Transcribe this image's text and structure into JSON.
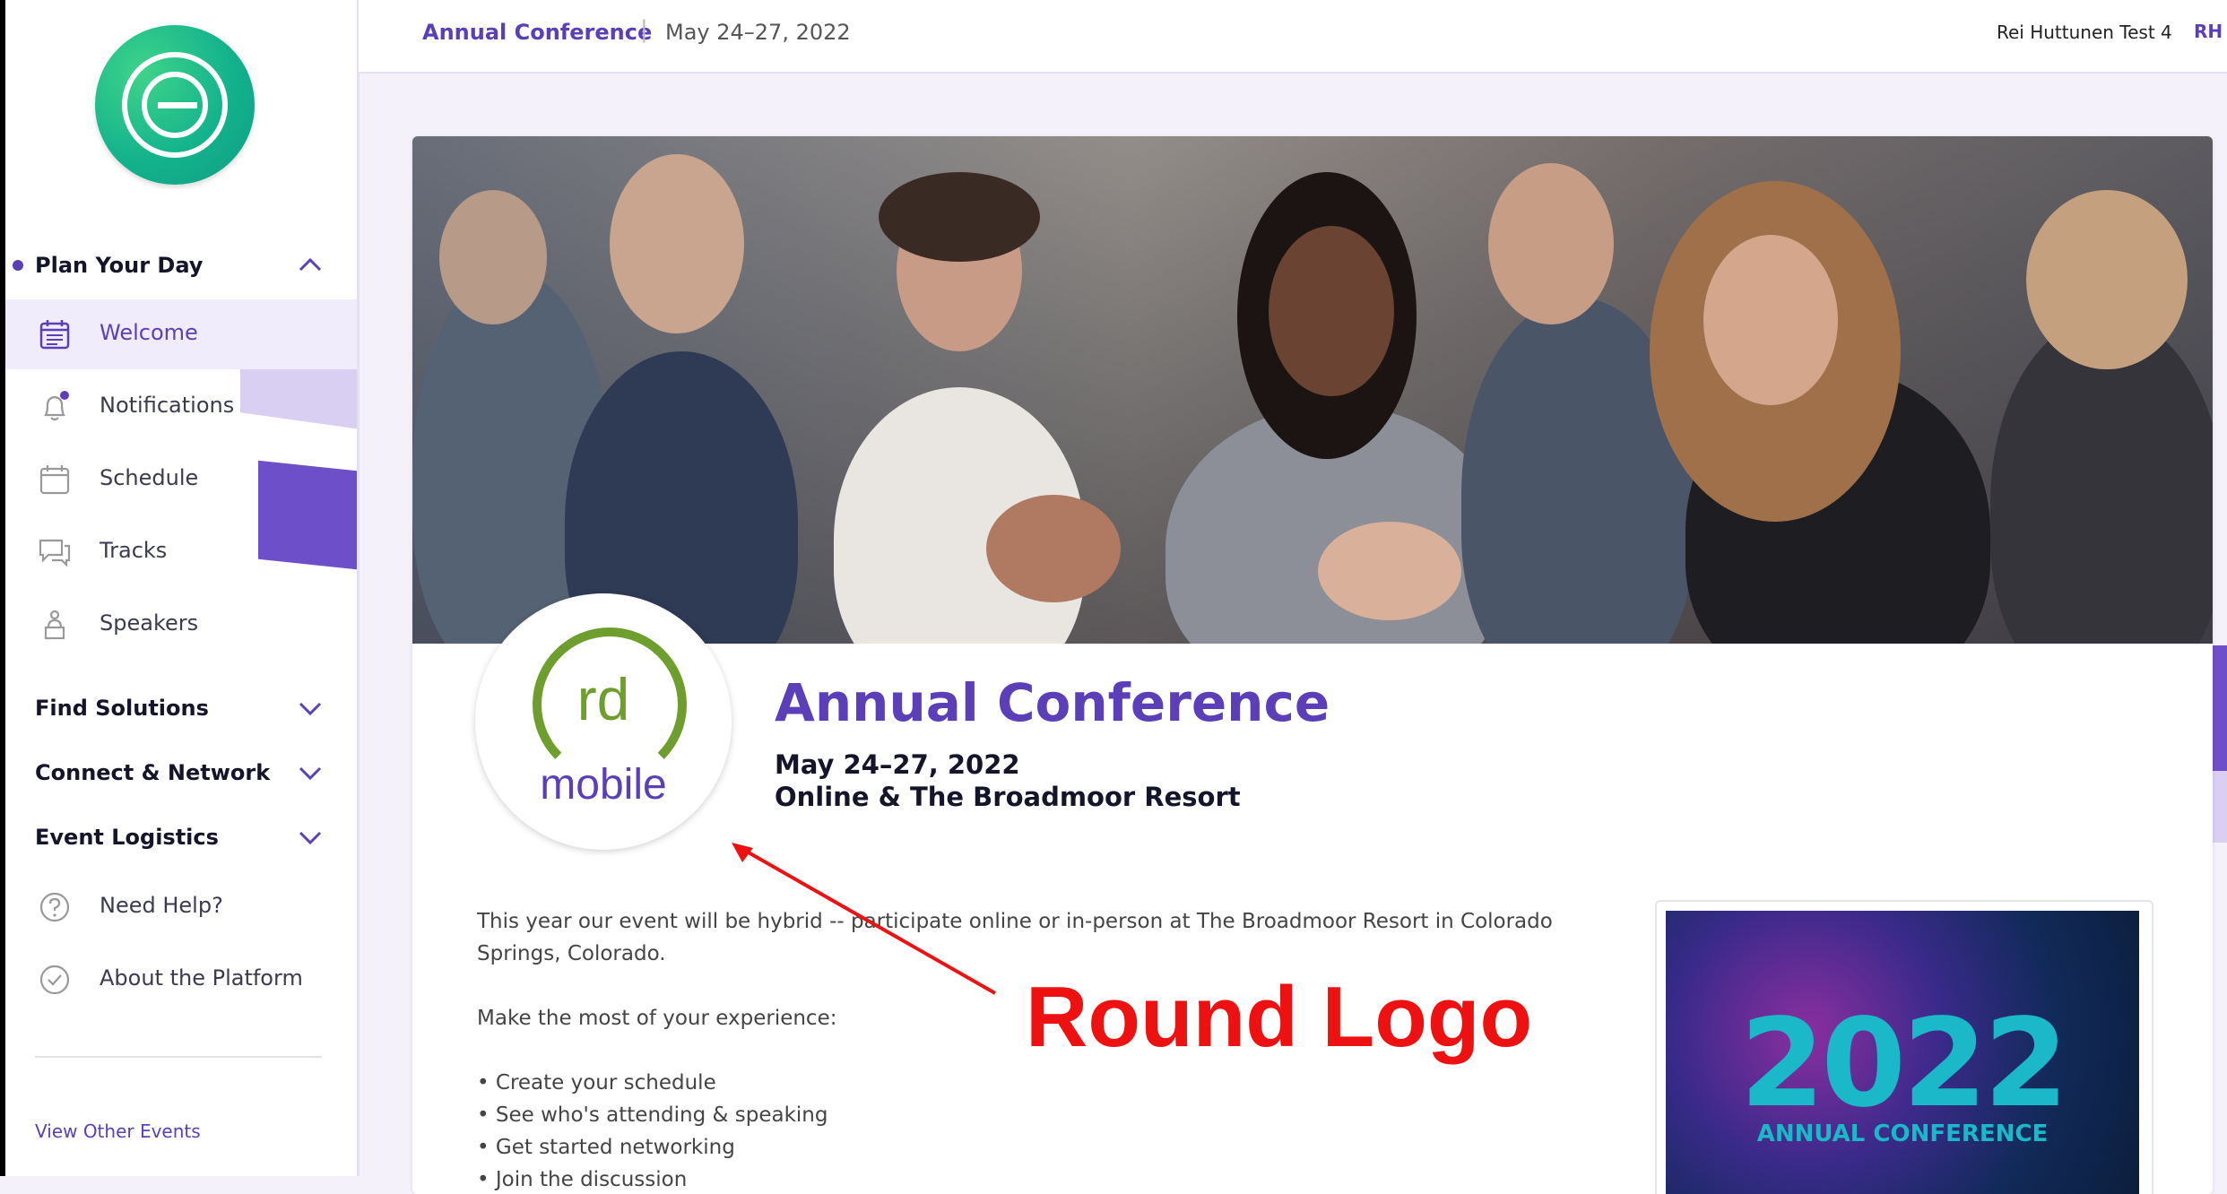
{
  "header": {
    "event_name": "Annual Conference",
    "separator": "|",
    "dates": "May 24–27, 2022",
    "user_name": "Rei Huttunen Test 4",
    "user_initials": "RH"
  },
  "sidebar": {
    "sections": [
      {
        "label": "Plan Your Day",
        "expanded": true
      },
      {
        "label": "Find Solutions",
        "expanded": false
      },
      {
        "label": "Connect & Network",
        "expanded": false
      },
      {
        "label": "Event Logistics",
        "expanded": false
      }
    ],
    "plan_items": [
      {
        "label": "Welcome",
        "icon": "calendar-list-icon",
        "active": true
      },
      {
        "label": "Notifications",
        "icon": "bell-icon",
        "active": false
      },
      {
        "label": "Schedule",
        "icon": "calendar-icon",
        "active": false
      },
      {
        "label": "Tracks",
        "icon": "chat-bubbles-icon",
        "active": false
      },
      {
        "label": "Speakers",
        "icon": "speaker-podium-icon",
        "active": false
      }
    ],
    "extra_items": [
      {
        "label": "Need Help?",
        "icon": "question-icon"
      },
      {
        "label": "About the Platform",
        "icon": "check-circle-icon"
      }
    ],
    "view_other": "View Other Events"
  },
  "main": {
    "logo": {
      "top": "rd",
      "bottom": "mobile"
    },
    "title": "Annual Conference",
    "dates": "May 24–27, 2022",
    "venue": "Online & The Broadmoor Resort",
    "intro": "This year our event will be hybrid -- participate online or in-person at The Broadmoor Resort in Colorado Springs, Colorado.",
    "lead": "Make the most of your experience:",
    "bullets": [
      "Create your schedule",
      "See who's attending & speaking",
      "Get started networking",
      "Join the discussion"
    ],
    "promo": {
      "year": "2022",
      "subtitle": "ANNUAL CONFERENCE"
    }
  },
  "annotation": {
    "label": "Round Logo"
  },
  "colors": {
    "accent": "#5a3fb8",
    "logo_green": "#6e9e2e",
    "annotation_red": "#ee1111"
  }
}
